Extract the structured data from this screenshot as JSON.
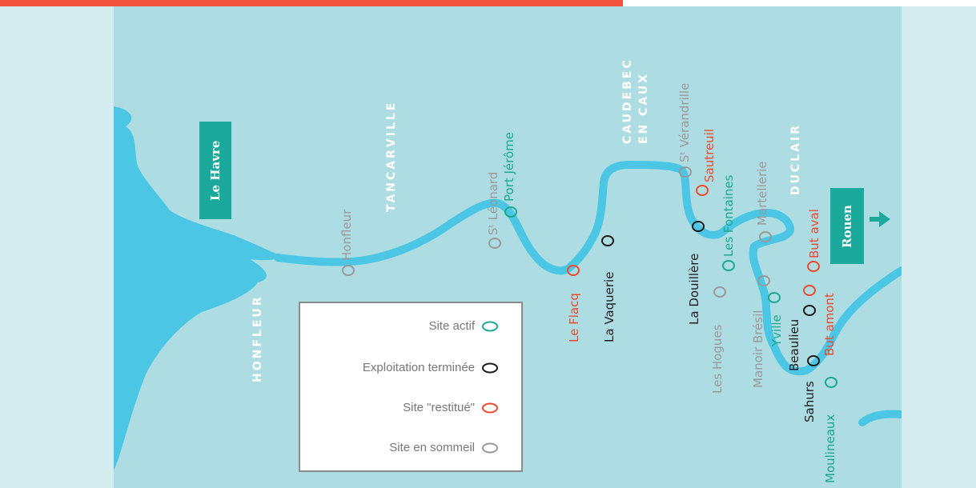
{
  "colors": {
    "water": "#4bc6e4",
    "land": "#addde3",
    "accent_bar": "#f2533c",
    "active": "#1aa98f",
    "finished": "#1a1a1a",
    "restored": "#ee4a2c",
    "dormant": "#999999",
    "city_box": "#1aa99a"
  },
  "cities": {
    "le_havre": "Le Havre",
    "rouen": "Rouen"
  },
  "towns": {
    "tancarville": "TANCARVILLE",
    "honfleur": "HONFLEUR",
    "caudebec_line1": "CAUDEBEC",
    "caudebec_line2": "EN CAUX",
    "duclair": "DUCLAIR"
  },
  "sites": {
    "honfleur": "Honfleur",
    "st_leonard": "Sᵗ Léonard",
    "port_jerome": "Port Jérôme",
    "le_flacq": "Le Flacq",
    "la_vaquerie": "La Vaquerie",
    "st_verandrille": "Sᵗ Vérandrille",
    "sautreuil": "Sautreuil",
    "les_fontaines": "Les Fontaines",
    "la_douillere": "La Douillère",
    "les_hogues": "Les Hogues",
    "martellerie": "Martellerie",
    "manoir_bresil": "Manoir Brésil",
    "yville": "Yville",
    "beaulieu": "Beaulieu",
    "but_aval": "But aval",
    "but_amont": "But amont",
    "sahurs": "Sahurs",
    "moulineaux": "Moulineaux"
  },
  "legend": {
    "items": [
      {
        "label": "Site actif",
        "status": "active"
      },
      {
        "label": "Exploitation terminée",
        "status": "finished"
      },
      {
        "label": "Site \"restitué\"",
        "status": "restored"
      },
      {
        "label": "Site en sommeil",
        "status": "dormant"
      }
    ]
  }
}
